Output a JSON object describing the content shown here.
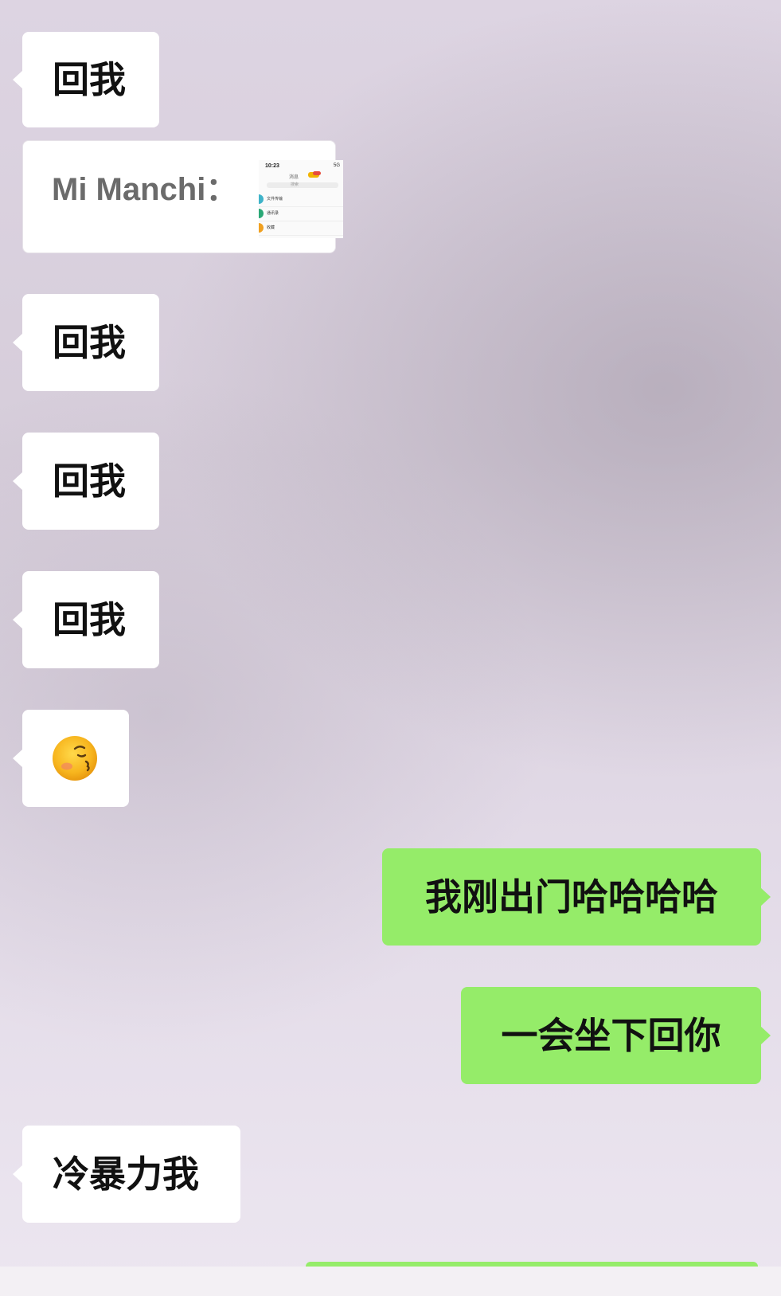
{
  "chat": {
    "messages": [
      {
        "side": "in",
        "type": "text",
        "text": "回我"
      },
      {
        "side": "in",
        "type": "quote",
        "sender": "Mi Manchi：",
        "thumbnail": {
          "status_time": "10:23",
          "status_right": "5G",
          "tab_label": "消息",
          "search_hint": "搜索",
          "rows": [
            "文件传输",
            "通讯录",
            "收藏"
          ]
        }
      },
      {
        "side": "in",
        "type": "text",
        "text": "回我"
      },
      {
        "side": "in",
        "type": "text",
        "text": "回我"
      },
      {
        "side": "in",
        "type": "text",
        "text": "回我"
      },
      {
        "side": "in",
        "type": "emoji",
        "emoji": "smirk-face-emoji"
      },
      {
        "side": "out",
        "type": "text",
        "text": "我刚出门哈哈哈哈"
      },
      {
        "side": "out",
        "type": "text",
        "text": "一会坐下回你"
      },
      {
        "side": "in",
        "type": "text",
        "text": "冷暴力我"
      }
    ]
  },
  "colors": {
    "incoming_bubble": "#ffffff",
    "outgoing_bubble": "#95ec69",
    "text": "#111111",
    "sender_name": "#6b6b6b"
  }
}
